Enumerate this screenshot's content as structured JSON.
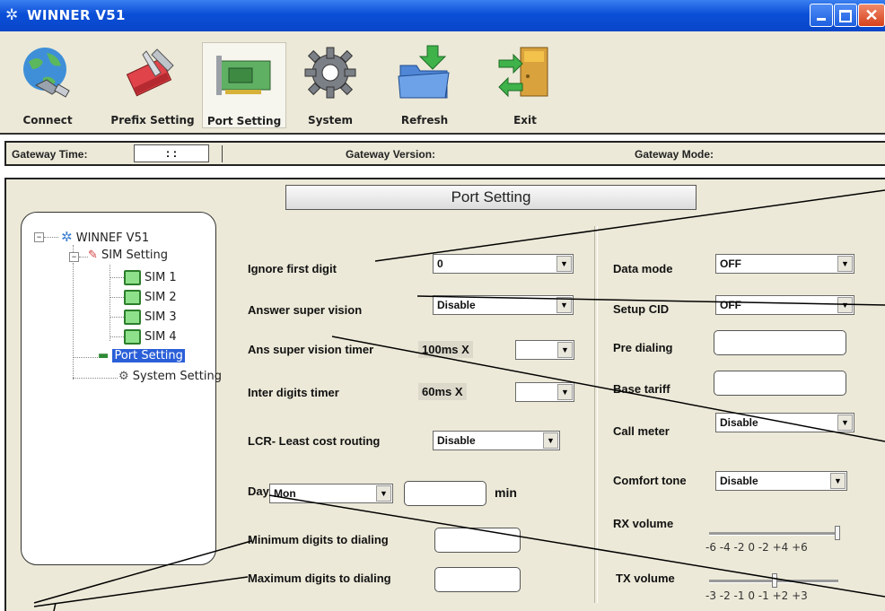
{
  "window": {
    "title": "WINNER V51"
  },
  "toolbar": {
    "connect": "Connect",
    "prefix_setting": "Prefix Setting",
    "port_setting": "Port Setting",
    "system": "System",
    "refresh": "Refresh",
    "exit": "Exit"
  },
  "status": {
    "gateway_time_label": "Gateway Time:",
    "gateway_time_value": ":  :",
    "gateway_version_label": "Gateway Version:",
    "gateway_mode_label": "Gateway Mode:"
  },
  "panel": {
    "title": "Port Setting"
  },
  "tree": {
    "root": "WINNEF V51",
    "sim_setting": "SIM Setting",
    "sims": [
      "SIM 1",
      "SIM 2",
      "SIM 3",
      "SIM 4"
    ],
    "port_setting": "Port Setting",
    "system_setting": "System Setting"
  },
  "form": {
    "ignore_first_digit": {
      "label": "Ignore first digit",
      "value": "0"
    },
    "answer_super_vision": {
      "label": "Answer super vision",
      "value": "Disable"
    },
    "ans_super_vision_timer": {
      "label": "Ans super vision timer",
      "unit": "100ms X",
      "value": ""
    },
    "inter_digits_timer": {
      "label": "Inter digits timer",
      "unit": "60ms X",
      "value": ""
    },
    "lcr": {
      "label": "LCR- Least cost routing",
      "value": "Disable"
    },
    "day": {
      "label": "Day",
      "value": "Mon",
      "minutes": "",
      "min_label": "min"
    },
    "minimum_digits": {
      "label": "Minimum digits to dialing",
      "value": ""
    },
    "maximum_digits": {
      "label": "Maximum digits to dialing",
      "value": ""
    },
    "data_mode": {
      "label": "Data mode",
      "value": "OFF"
    },
    "setup_cid": {
      "label": "Setup CID",
      "value": "OFF"
    },
    "pre_dialing": {
      "label": "Pre dialing",
      "value": ""
    },
    "base_tariff": {
      "label": "Base tariff",
      "value": ""
    },
    "call_meter": {
      "label": "Call meter",
      "value": "Disable"
    },
    "comfort_tone": {
      "label": "Comfort tone",
      "value": "Disable"
    },
    "rx_volume": {
      "label": "RX volume",
      "ticks": "-6 -4 -2  0  -2 +4 +6",
      "level": 1.0
    },
    "tx_volume": {
      "label": "TX volume",
      "ticks": "-3 -2 -1  0  -1 +2 +3",
      "level": 0.5
    }
  },
  "colors": {
    "titlebar": "#0b4fd8",
    "panel_bg": "#ece9d8",
    "close_button": "#d6411c"
  }
}
